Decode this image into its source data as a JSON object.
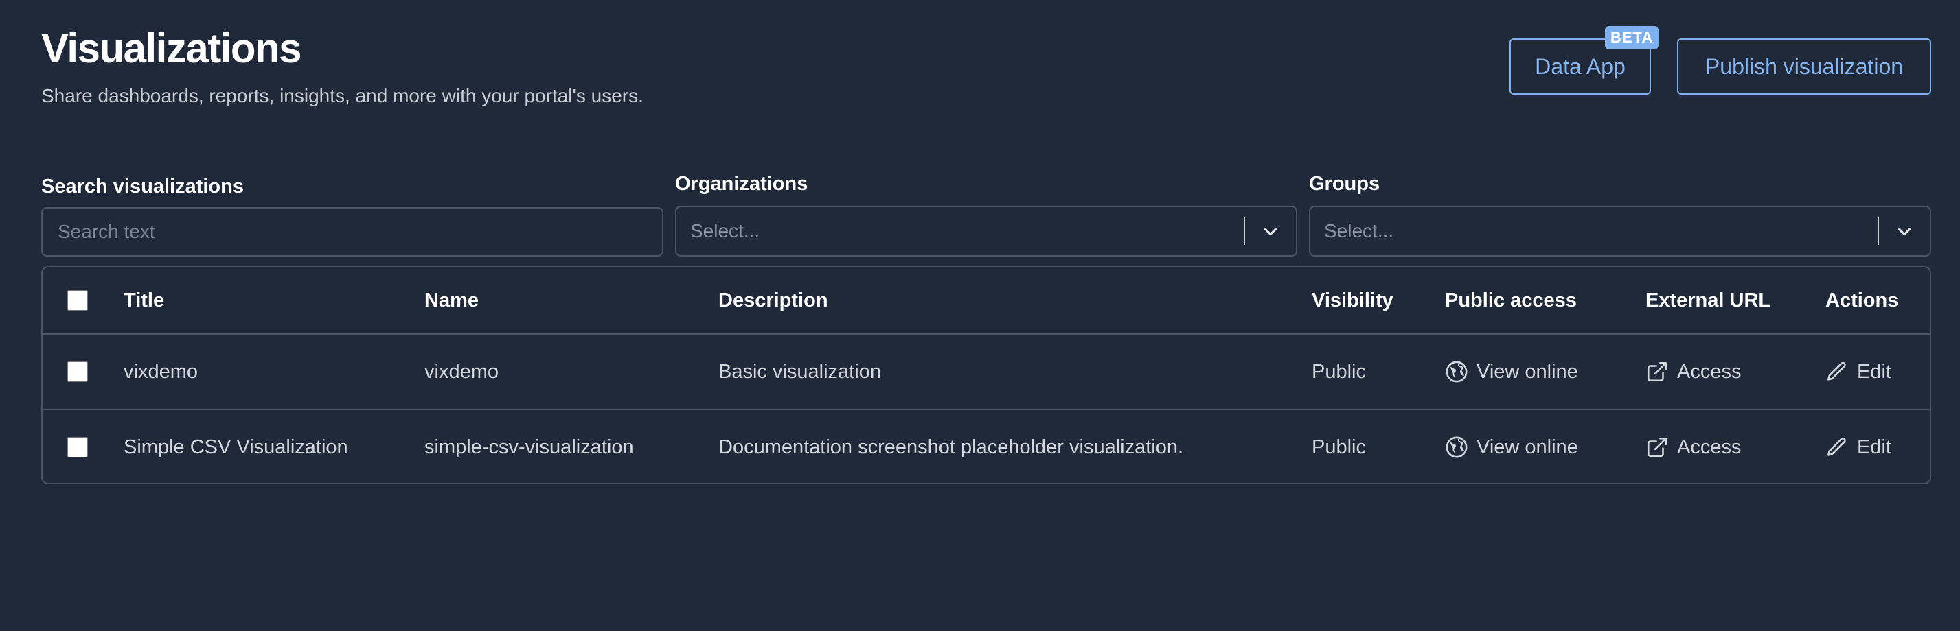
{
  "header": {
    "title": "Visualizations",
    "subtitle": "Share dashboards, reports, insights, and more with your portal's users."
  },
  "actions": {
    "data_app_label": "Data App",
    "beta_badge": "BETA",
    "publish_label": "Publish visualization"
  },
  "filters": {
    "search_label": "Search visualizations",
    "search_placeholder": "Search text",
    "search_value": "",
    "organizations_label": "Organizations",
    "organizations_placeholder": "Select...",
    "groups_label": "Groups",
    "groups_placeholder": "Select..."
  },
  "table": {
    "columns": [
      "Title",
      "Name",
      "Description",
      "Visibility",
      "Public access",
      "External URL",
      "Actions"
    ],
    "rows": [
      {
        "title": "vixdemo",
        "name": "vixdemo",
        "description": "Basic visualization",
        "visibility": "Public",
        "public_access": "View online",
        "external_url": "Access",
        "action": "Edit"
      },
      {
        "title": "Simple CSV Visualization",
        "name": "simple-csv-visualization",
        "description": "Documentation screenshot placeholder visualization.",
        "visibility": "Public",
        "public_access": "View online",
        "external_url": "Access",
        "action": "Edit"
      }
    ]
  },
  "colors": {
    "background": "#202939",
    "accent": "#86b6f2",
    "border": "#4b5566"
  },
  "icons": {
    "public_access": "globe-icon",
    "external_url": "external-link-icon",
    "action": "pencil-icon",
    "select": "chevron-down-icon"
  }
}
